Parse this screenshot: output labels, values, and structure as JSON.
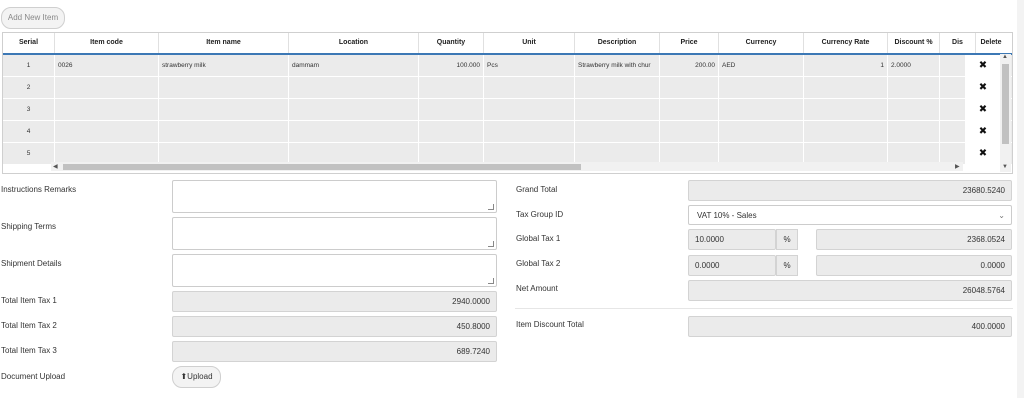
{
  "toolbar": {
    "add_item_label": "Add New Item"
  },
  "table": {
    "columns": [
      "Serial",
      "Item code",
      "Item name",
      "Location",
      "Quantity",
      "Unit",
      "Description",
      "Price",
      "Currency",
      "Currency Rate",
      "Discount %",
      "Dis",
      "Delete"
    ],
    "rows": [
      {
        "serial": "1",
        "item_code": "0026",
        "item_name": "strawberry milk",
        "location": "dammam",
        "quantity": "100.000",
        "unit": "Pcs",
        "description": "Strawberry milk with chur",
        "price": "200.00",
        "currency": "AED",
        "currency_rate": "1",
        "discount": "2.0000",
        "dis": ""
      },
      {
        "serial": "2",
        "item_code": "",
        "item_name": "",
        "location": "",
        "quantity": "",
        "unit": "",
        "description": "",
        "price": "",
        "currency": "",
        "currency_rate": "",
        "discount": "",
        "dis": ""
      },
      {
        "serial": "3",
        "item_code": "",
        "item_name": "",
        "location": "",
        "quantity": "",
        "unit": "",
        "description": "",
        "price": "",
        "currency": "",
        "currency_rate": "",
        "discount": "",
        "dis": ""
      },
      {
        "serial": "4",
        "item_code": "",
        "item_name": "",
        "location": "",
        "quantity": "",
        "unit": "",
        "description": "",
        "price": "",
        "currency": "",
        "currency_rate": "",
        "discount": "",
        "dis": ""
      },
      {
        "serial": "5",
        "item_code": "",
        "item_name": "",
        "location": "",
        "quantity": "",
        "unit": "",
        "description": "",
        "price": "",
        "currency": "",
        "currency_rate": "",
        "discount": "",
        "dis": ""
      }
    ],
    "delete_icon": "✖"
  },
  "left_form": {
    "instructions_label": "Instructions Remarks",
    "shipping_terms_label": "Shipping Terms",
    "shipment_details_label": "Shipment Details",
    "total_item_tax1_label": "Total Item Tax 1",
    "total_item_tax1_value": "2940.0000",
    "total_item_tax2_label": "Total Item Tax 2",
    "total_item_tax2_value": "450.8000",
    "total_item_tax3_label": "Total Item Tax 3",
    "total_item_tax3_value": "689.7240",
    "document_upload_label": "Document Upload",
    "upload_button_label": "Upload"
  },
  "right_form": {
    "grand_total_label": "Grand Total",
    "grand_total_value": "23680.5240",
    "tax_group_label": "Tax Group ID",
    "tax_group_value": "VAT 10% - Sales",
    "global_tax1_label": "Global Tax 1",
    "global_tax1_rate": "10.0000",
    "global_tax1_amount": "2368.0524",
    "global_tax2_label": "Global Tax 2",
    "global_tax2_rate": "0.0000",
    "global_tax2_amount": "0.0000",
    "percent_symbol": "%",
    "net_amount_label": "Net Amount",
    "net_amount_value": "26048.5764",
    "item_discount_total_label": "Item Discount Total",
    "item_discount_total_value": "400.0000"
  }
}
